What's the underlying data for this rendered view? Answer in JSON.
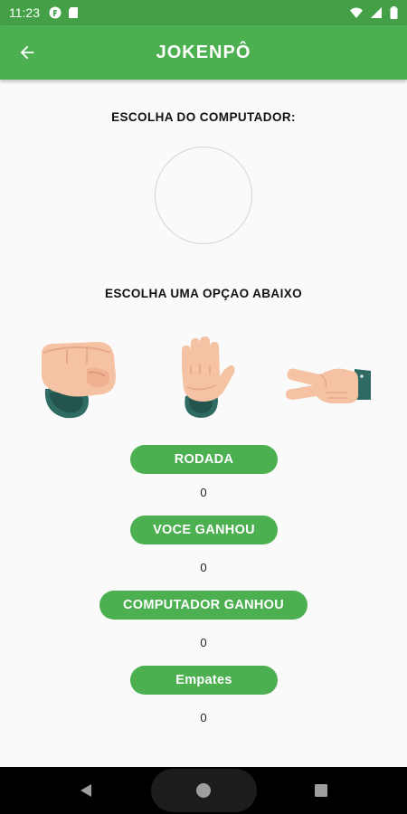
{
  "status_bar": {
    "time": "11:23"
  },
  "app_bar": {
    "title": "JOKENPÔ"
  },
  "computer_section": {
    "label": "ESCOLHA DO COMPUTADOR:"
  },
  "choice_section": {
    "label": "ESCOLHA UMA OPÇAO ABAIXO",
    "options": [
      "rock-hand-icon",
      "paper-hand-icon",
      "scissors-hand-icon"
    ]
  },
  "score": {
    "round_label": "RODADA",
    "round_value": "0",
    "player_label": "VOCE GANHOU",
    "player_value": "0",
    "computer_label": "COMPUTADOR GANHOU",
    "computer_value": "0",
    "draw_label": "Empates",
    "draw_value": "0"
  },
  "colors": {
    "primary": "#4caf50",
    "status_bar": "#43a047",
    "skin": "#f6c2a4",
    "sleeve": "#2f6b63"
  }
}
